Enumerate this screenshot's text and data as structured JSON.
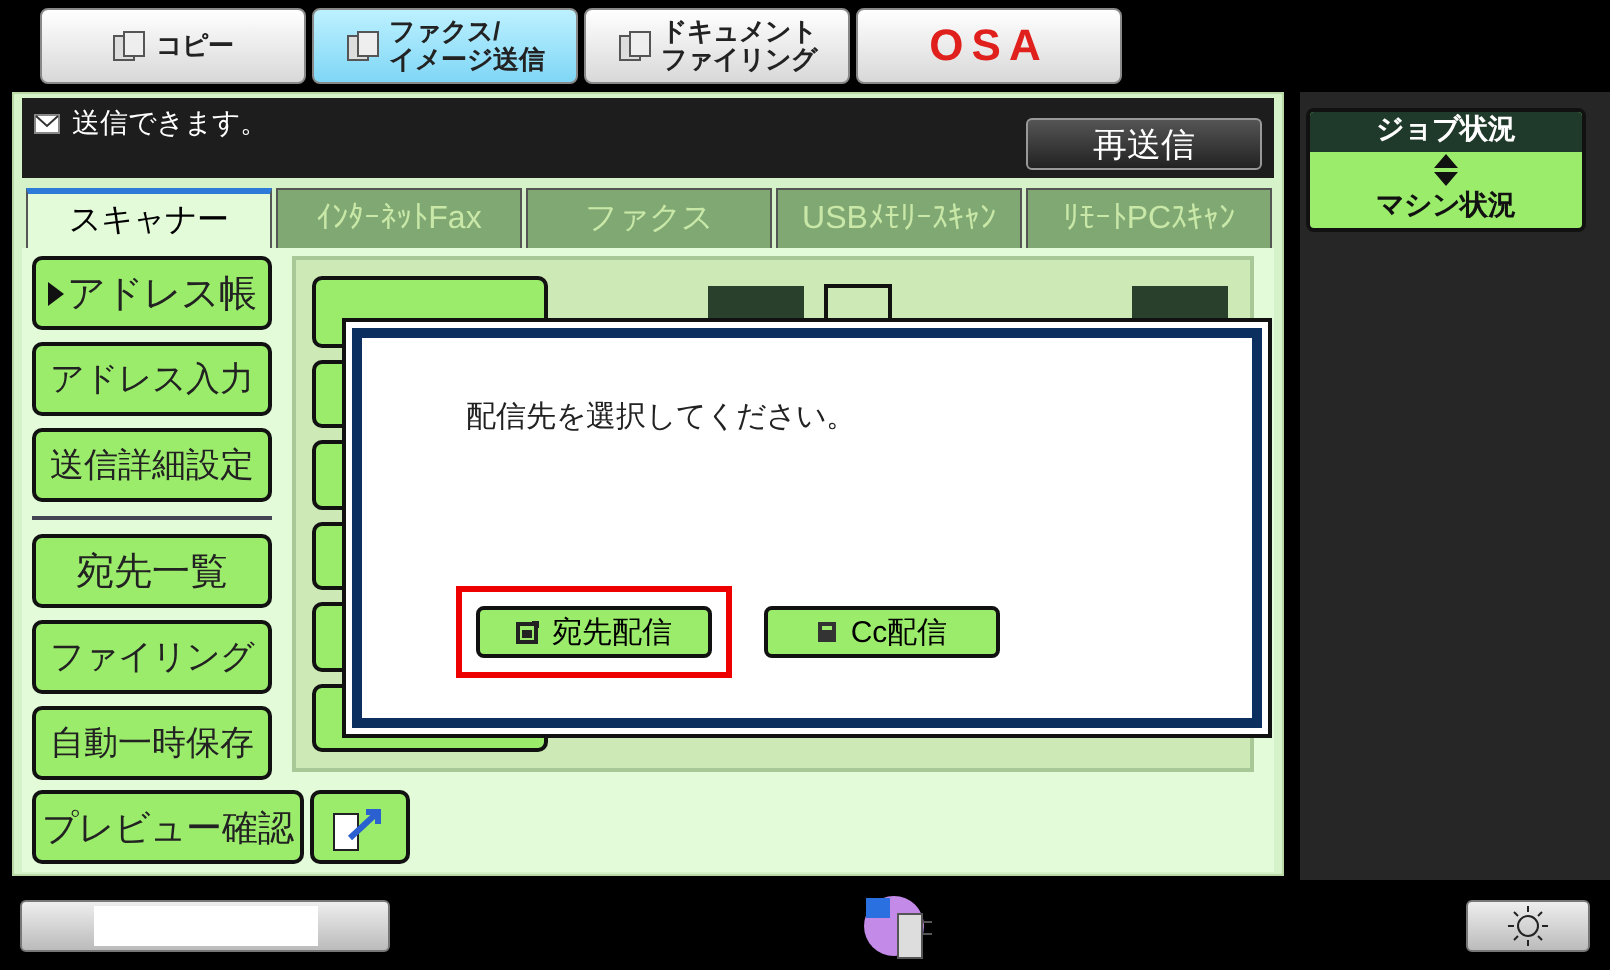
{
  "mode_tabs": [
    {
      "kind": "mode",
      "lines": [
        "コピー"
      ],
      "selected": false
    },
    {
      "kind": "mode",
      "lines": [
        "ファクス/",
        "イメージ送信"
      ],
      "selected": true
    },
    {
      "kind": "mode",
      "lines": [
        "ドキュメント",
        "ファイリング"
      ],
      "selected": false
    },
    {
      "kind": "logo",
      "lines": [
        "OSA"
      ],
      "selected": false
    }
  ],
  "status": {
    "message": "送信できます。",
    "resend_button": "再送信"
  },
  "scanner_tabs": [
    {
      "label": "スキャナー",
      "selected": true
    },
    {
      "label": "ｲﾝﾀｰﾈｯﾄFax",
      "selected": false
    },
    {
      "label": "ファクス",
      "selected": false
    },
    {
      "label": "USBﾒﾓﾘｰｽｷｬﾝ",
      "selected": false
    },
    {
      "label": "ﾘﾓｰﾄPCｽｷｬﾝ",
      "selected": false
    }
  ],
  "job_status": {
    "top": "ジョブ状況",
    "bottom": "マシン状況"
  },
  "side_groups": [
    [
      {
        "label": "アドレス帳",
        "selected": true
      },
      {
        "label": "アドレス入力",
        "selected": false
      },
      {
        "label": "送信詳細設定",
        "selected": false
      }
    ],
    [
      {
        "label": "宛先一覧",
        "selected": false
      },
      {
        "label": "ファイリング",
        "selected": false
      },
      {
        "label": "自動一時保存",
        "selected": false
      }
    ]
  ],
  "preview_button": "プレビュー確認",
  "dialog": {
    "message": "配信先を選択してください。",
    "buttons": [
      {
        "kind": "to",
        "label": "宛先配信",
        "highlighted": true
      },
      {
        "kind": "cc",
        "label": "Cc配信",
        "highlighted": false
      }
    ]
  }
}
